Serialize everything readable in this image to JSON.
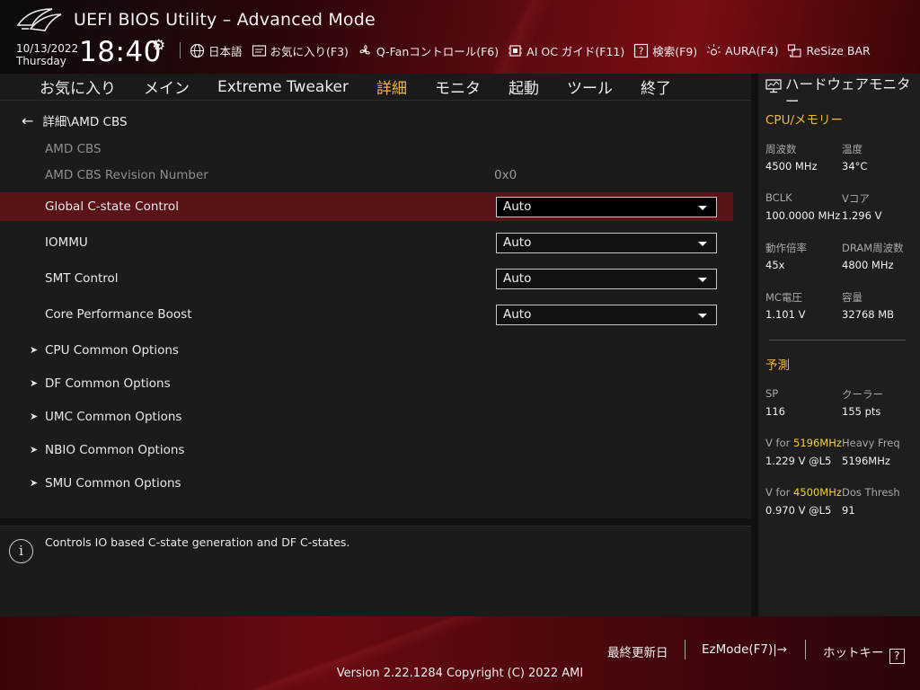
{
  "header": {
    "title": "UEFI BIOS Utility – Advanced Mode",
    "date": "10/13/2022",
    "day": "Thursday",
    "time": "18:40",
    "toolbar": [
      {
        "label": "日本語",
        "icon": "globe-icon"
      },
      {
        "label": "お気に入り(F3)",
        "icon": "favorites-icon"
      },
      {
        "label": "Q-Fanコントロール(F6)",
        "icon": "fan-icon"
      },
      {
        "label": "AI OC ガイド(F11)",
        "icon": "ai-oc-icon"
      },
      {
        "label": "検索(F9)",
        "icon": "search-help-icon"
      },
      {
        "label": "AURA(F4)",
        "icon": "aura-icon"
      },
      {
        "label": "ReSize BAR",
        "icon": "resize-bar-icon"
      }
    ]
  },
  "menu": {
    "tabs": [
      "お気に入り",
      "メイン",
      "Extreme Tweaker",
      "詳細",
      "モニタ",
      "起動",
      "ツール",
      "終了"
    ],
    "active": "詳細"
  },
  "breadcrumb": "詳細\\AMD CBS",
  "settings": {
    "title_label": "AMD CBS",
    "revision_label": "AMD CBS Revision Number",
    "revision_value": "0x0",
    "items": [
      {
        "label": "Global C-state Control",
        "value": "Auto"
      },
      {
        "label": "IOMMU",
        "value": "Auto"
      },
      {
        "label": "SMT Control",
        "value": "Auto"
      },
      {
        "label": "Core Performance Boost",
        "value": "Auto"
      }
    ],
    "submenus": [
      "CPU Common Options",
      "DF Common Options",
      "UMC Common Options",
      "NBIO Common Options",
      "SMU Common Options"
    ]
  },
  "help_text": "Controls IO based C-state generation and DF C-states.",
  "monitor": {
    "title": "ハードウェアモニター",
    "cpu_section": "CPU/メモリー",
    "cpu_items": [
      {
        "label": "周波数",
        "value": "4500 MHz"
      },
      {
        "label": "温度",
        "value": "34°C"
      },
      {
        "label": "BCLK",
        "value": "100.0000 MHz"
      },
      {
        "label": "Vコア",
        "value": "1.296 V"
      },
      {
        "label": "動作倍率",
        "value": "45x"
      },
      {
        "label": "DRAM周波数",
        "value": "4800 MHz"
      },
      {
        "label": "MC電圧",
        "value": "1.101 V"
      },
      {
        "label": "容量",
        "value": "32768 MB"
      }
    ],
    "predict_section": "予測",
    "predict": {
      "sp_label": "SP",
      "sp_value": "116",
      "cooler_label": "クーラー",
      "cooler_value": "155 pts",
      "v1_prefix": "V for ",
      "v1_freq": "5196MHz",
      "v1_value": "1.229 V @L5",
      "hf_label": "Heavy Freq",
      "hf_value": "5196MHz",
      "v2_prefix": "V for ",
      "v2_freq": "4500MHz",
      "v2_value": "0.970 V @L5",
      "dt_label": "Dos Thresh",
      "dt_value": "91"
    }
  },
  "footer": {
    "last_modified": "最終更新日",
    "ezmode": "EzMode(F7)|",
    "hotkeys": "ホットキー",
    "hotkeys_key": "?",
    "version": "Version 2.22.1284 Copyright (C) 2022 AMI"
  },
  "colors": {
    "accent": "#f4b73c",
    "selected_row": "#5a1418",
    "highlight": "#f4d03c"
  }
}
